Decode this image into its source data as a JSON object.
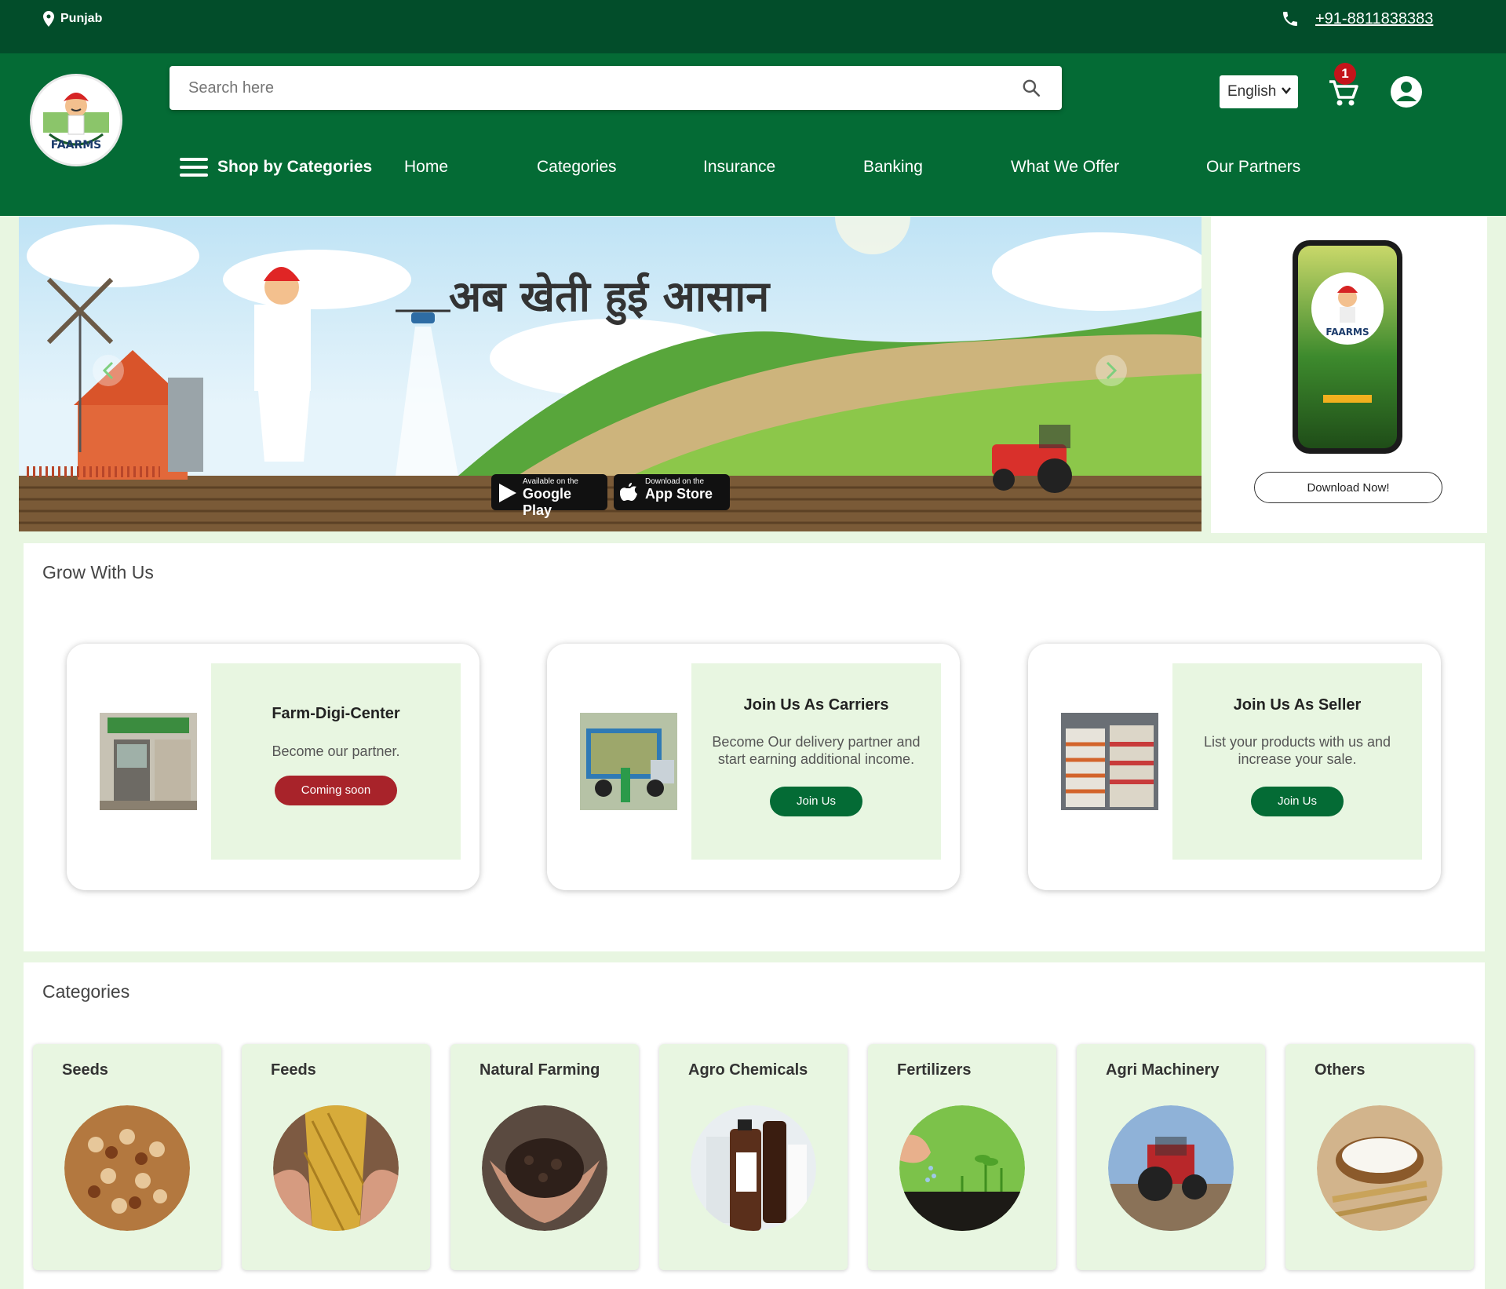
{
  "topbar": {
    "location": "Punjab",
    "phone": "+91-8811838383"
  },
  "header": {
    "search_placeholder": "Search here",
    "language": "English",
    "cart_count": "1",
    "logo_text": "FAARMS"
  },
  "nav": {
    "shop_by_categories": "Shop by Categories",
    "items": [
      "Home",
      "Categories",
      "Insurance",
      "Banking",
      "What We Offer",
      "Our Partners"
    ]
  },
  "banner": {
    "slogan": "अब खेती हुई आसान",
    "google_play_small": "Available on the",
    "google_play_big": "Google Play",
    "app_store_small": "Download on the",
    "app_store_big": "App Store"
  },
  "promo": {
    "download_label": "Download Now!"
  },
  "grow": {
    "title": "Grow With Us",
    "cards": [
      {
        "title": "Farm-Digi-Center",
        "desc": "Become our partner.",
        "button": "Coming soon"
      },
      {
        "title": "Join Us As Carriers",
        "desc": "Become Our delivery partner and start earning additional income.",
        "button": "Join Us"
      },
      {
        "title": "Join Us As Seller",
        "desc": "List your products with us and increase your sale.",
        "button": "Join Us"
      }
    ]
  },
  "categories": {
    "title": "Categories",
    "items": [
      "Seeds",
      "Feeds",
      "Natural Farming",
      "Agro Chemicals",
      "Fertilizers",
      "Agri Machinery",
      "Others"
    ]
  },
  "colors": {
    "topbar": "#024d2a",
    "header": "#046b35",
    "light_green": "#e8f6e1",
    "join_button": "#046b35",
    "coming_soon_button": "#a8232a",
    "badge": "#c4141a"
  },
  "icons": [
    "map-pin-icon",
    "phone-icon",
    "search-icon",
    "cart-icon",
    "user-icon",
    "hamburger-icon",
    "google-play-icon",
    "apple-icon",
    "chevron-left-icon",
    "chevron-right-icon"
  ]
}
